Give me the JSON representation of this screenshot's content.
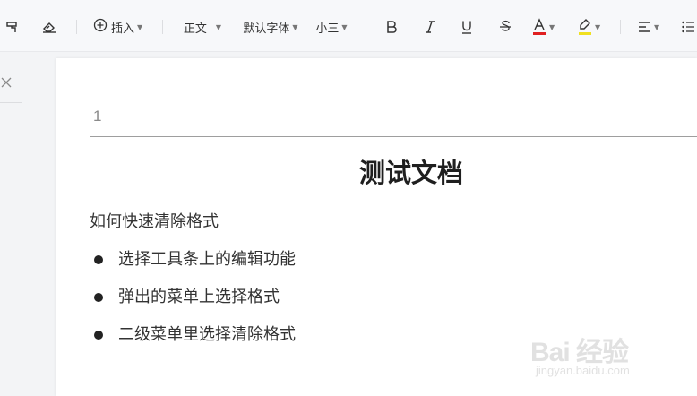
{
  "toolbar": {
    "insert_label": "插入",
    "style_label": "正文",
    "font_label": "默认字体",
    "size_label": "小三",
    "colors": {
      "font_color_underline": "#e02020",
      "highlight_underline": "#f0e020"
    },
    "icons": [
      "format-painter-icon",
      "eraser-icon",
      "plus-circle-icon",
      "bold-icon",
      "italic-icon",
      "underline-icon",
      "strikethrough-icon",
      "font-color-icon",
      "highlight-icon",
      "align-left-icon",
      "list-icon"
    ]
  },
  "left_panel": {
    "icons": [
      "close-icon"
    ]
  },
  "document": {
    "page_number": "1",
    "title": "测试文档",
    "paragraph": "如何快速清除格式",
    "bullets": [
      "选择工具条上的编辑功能",
      "弹出的菜单上选择格式",
      "二级菜单里选择清除格式"
    ]
  },
  "watermark": {
    "main": "Bai 经验",
    "sub": "jingyan.baidu.com"
  }
}
